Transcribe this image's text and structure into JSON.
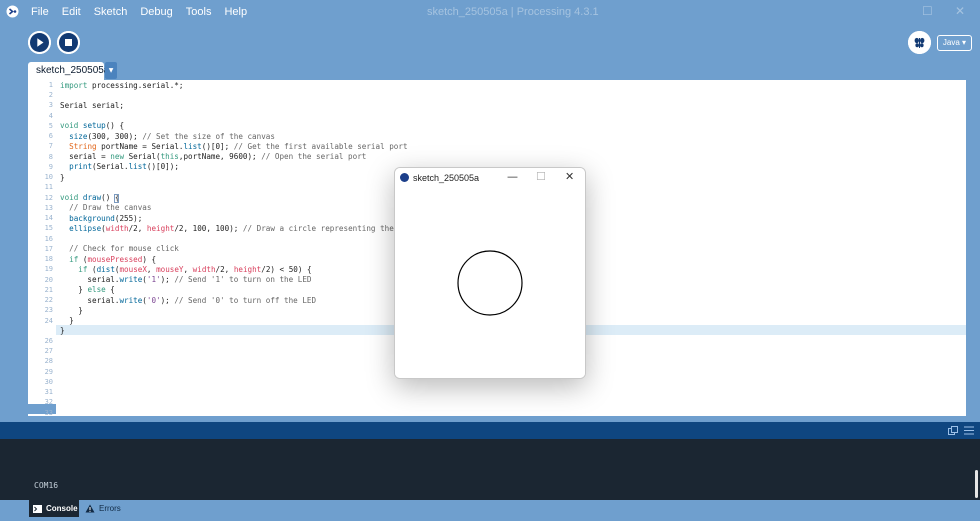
{
  "window": {
    "title": "sketch_250505a | Processing 4.3.1",
    "minimize_glyph": "—",
    "maximize_glyph": "☐",
    "close_glyph": "✕"
  },
  "menu": [
    "File",
    "Edit",
    "Sketch",
    "Debug",
    "Tools",
    "Help"
  ],
  "toolbar": {
    "run_icon": "play-icon",
    "stop_icon": "stop-icon",
    "debug_icon": "butterfly-icon",
    "mode_label": "Java ▾"
  },
  "tab": {
    "label": "sketch_250505a",
    "menu_glyph": "▼"
  },
  "editor": {
    "line_numbers": [
      "1",
      "2",
      "3",
      "4",
      "5",
      "6",
      "7",
      "8",
      "9",
      "10",
      "11",
      "12",
      "13",
      "14",
      "15",
      "16",
      "17",
      "18",
      "19",
      "20",
      "21",
      "22",
      "23",
      "24",
      "25",
      "26",
      "27",
      "28",
      "29",
      "30",
      "31",
      "32",
      "33"
    ],
    "current_line": "25",
    "code": [
      [
        {
          "t": "import",
          "c": "kw"
        },
        {
          "t": " processing.serial.*;",
          "c": ""
        }
      ],
      [],
      [
        {
          "t": "Serial serial;",
          "c": ""
        }
      ],
      [],
      [
        {
          "t": "void",
          "c": "kw"
        },
        {
          "t": " ",
          "c": ""
        },
        {
          "t": "setup",
          "c": "fn"
        },
        {
          "t": "() {",
          "c": ""
        }
      ],
      [
        {
          "t": "  ",
          "c": ""
        },
        {
          "t": "size",
          "c": "fn"
        },
        {
          "t": "(300, 300); ",
          "c": ""
        },
        {
          "t": "// Set the size of the canvas",
          "c": "cm"
        }
      ],
      [
        {
          "t": "  ",
          "c": ""
        },
        {
          "t": "String",
          "c": "ty"
        },
        {
          "t": " portName = Serial.",
          "c": ""
        },
        {
          "t": "list",
          "c": "fn"
        },
        {
          "t": "()[0]; ",
          "c": ""
        },
        {
          "t": "// Get the first available serial port",
          "c": "cm"
        }
      ],
      [
        {
          "t": "  serial = ",
          "c": ""
        },
        {
          "t": "new",
          "c": "kw"
        },
        {
          "t": " Serial(",
          "c": ""
        },
        {
          "t": "this",
          "c": "kw"
        },
        {
          "t": ",portName, 9600); ",
          "c": ""
        },
        {
          "t": "// Open the serial port",
          "c": "cm"
        }
      ],
      [
        {
          "t": "  ",
          "c": ""
        },
        {
          "t": "print",
          "c": "fn"
        },
        {
          "t": "(Serial.",
          "c": ""
        },
        {
          "t": "list",
          "c": "fn"
        },
        {
          "t": "()[0]);",
          "c": ""
        }
      ],
      [
        {
          "t": "}",
          "c": ""
        }
      ],
      [],
      [
        {
          "t": "void",
          "c": "kw"
        },
        {
          "t": " ",
          "c": ""
        },
        {
          "t": "draw",
          "c": "fn"
        },
        {
          "t": "() {",
          "c": ""
        }
      ],
      [
        {
          "t": "  ",
          "c": ""
        },
        {
          "t": "// Draw the canvas",
          "c": "cm"
        }
      ],
      [
        {
          "t": "  ",
          "c": ""
        },
        {
          "t": "background",
          "c": "fn"
        },
        {
          "t": "(255);",
          "c": ""
        }
      ],
      [
        {
          "t": "  ",
          "c": ""
        },
        {
          "t": "ellipse",
          "c": "fn"
        },
        {
          "t": "(",
          "c": ""
        },
        {
          "t": "width",
          "c": "vr"
        },
        {
          "t": "/2, ",
          "c": ""
        },
        {
          "t": "height",
          "c": "vr"
        },
        {
          "t": "/2, 100, 100); ",
          "c": ""
        },
        {
          "t": "// Draw a circle representing the LED",
          "c": "cm"
        }
      ],
      [],
      [
        {
          "t": "  ",
          "c": ""
        },
        {
          "t": "// Check for mouse click",
          "c": "cm"
        }
      ],
      [
        {
          "t": "  ",
          "c": ""
        },
        {
          "t": "if",
          "c": "kw"
        },
        {
          "t": " (",
          "c": ""
        },
        {
          "t": "mousePressed",
          "c": "vr"
        },
        {
          "t": ") {",
          "c": ""
        }
      ],
      [
        {
          "t": "    ",
          "c": ""
        },
        {
          "t": "if",
          "c": "kw"
        },
        {
          "t": " (",
          "c": ""
        },
        {
          "t": "dist",
          "c": "fn"
        },
        {
          "t": "(",
          "c": ""
        },
        {
          "t": "mouseX",
          "c": "vr"
        },
        {
          "t": ", ",
          "c": ""
        },
        {
          "t": "mouseY",
          "c": "vr"
        },
        {
          "t": ", ",
          "c": ""
        },
        {
          "t": "width",
          "c": "vr"
        },
        {
          "t": "/2, ",
          "c": ""
        },
        {
          "t": "height",
          "c": "vr"
        },
        {
          "t": "/2) < 50) {",
          "c": ""
        }
      ],
      [
        {
          "t": "      serial.",
          "c": ""
        },
        {
          "t": "write",
          "c": "fn"
        },
        {
          "t": "(",
          "c": ""
        },
        {
          "t": "'1'",
          "c": "st"
        },
        {
          "t": "); ",
          "c": ""
        },
        {
          "t": "// Send '1' to turn on the LED",
          "c": "cm"
        }
      ],
      [
        {
          "t": "    } ",
          "c": ""
        },
        {
          "t": "else",
          "c": "kw"
        },
        {
          "t": " {",
          "c": ""
        }
      ],
      [
        {
          "t": "      serial.",
          "c": ""
        },
        {
          "t": "write",
          "c": "fn"
        },
        {
          "t": "(",
          "c": ""
        },
        {
          "t": "'0'",
          "c": "st"
        },
        {
          "t": "); ",
          "c": ""
        },
        {
          "t": "// Send '0' to turn off the LED",
          "c": "cm"
        }
      ],
      [
        {
          "t": "    }",
          "c": ""
        }
      ],
      [
        {
          "t": "  }",
          "c": ""
        }
      ],
      [
        {
          "t": "}",
          "c": ""
        }
      ]
    ]
  },
  "sketch_window": {
    "title": "sketch_250505a",
    "minimize_glyph": "—",
    "maximize_glyph": "☐",
    "close_glyph": "✕",
    "drawing": {
      "shape": "circle",
      "fill": "#ffffff",
      "stroke": "#000000"
    }
  },
  "console": {
    "output": "COM16"
  },
  "bottom_tabs": {
    "console_label": "Console",
    "errors_label": "Errors"
  },
  "colors": {
    "chrome": "#6f9fce",
    "console_bg": "#1b2632",
    "strip": "#0f4680",
    "keyword": "#33997e",
    "function": "#006699",
    "type": "#e2661a",
    "variable": "#d9405d",
    "string": "#7d4793",
    "comment": "#666666"
  }
}
